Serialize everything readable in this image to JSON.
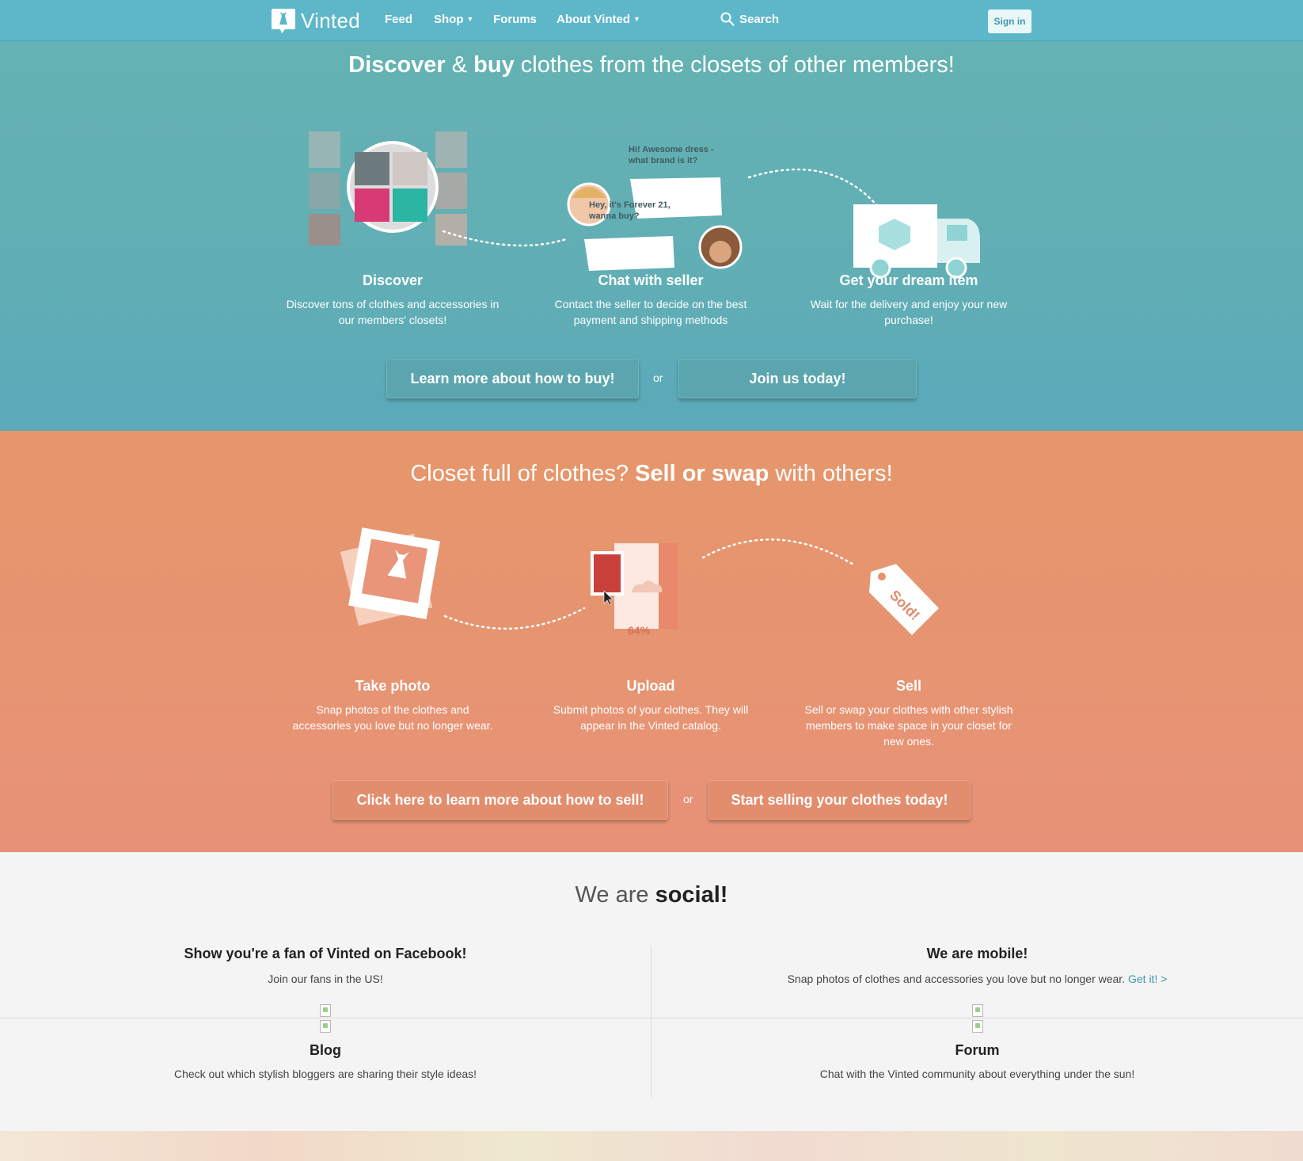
{
  "nav": {
    "brand": "Vinted",
    "links": [
      {
        "label": "Feed",
        "dropdown": false
      },
      {
        "label": "Shop",
        "dropdown": true
      },
      {
        "label": "Forums",
        "dropdown": false
      },
      {
        "label": "About Vinted",
        "dropdown": true
      }
    ],
    "search_label": "Search",
    "signin_label": "Sign in"
  },
  "buy": {
    "title_strong_1": "Discover",
    "title_mid": " & ",
    "title_strong_2": "buy",
    "title_rest": " clothes from the closets of other members!",
    "chat_bubble_1": "Hi! Awesome dress - what brand is it?",
    "chat_bubble_2": "Hey, it's Forever 21, wanna buy?",
    "steps": [
      {
        "title": "Discover",
        "text": "Discover tons of clothes and accessories in our members' closets!"
      },
      {
        "title": "Chat with seller",
        "text": "Contact the seller to decide on the best payment and shipping methods"
      },
      {
        "title": "Get your dream item",
        "text": "Wait for the delivery and enjoy your new purchase!"
      }
    ],
    "btn_learn": "Learn more about how to buy!",
    "or": "or",
    "btn_join": "Join us today!",
    "bg_color": "#62aeb5"
  },
  "sell": {
    "title_pre": "Closet full of clothes? ",
    "title_strong": "Sell or swap",
    "title_rest": " with others!",
    "upload_percent": "64%",
    "tag_text": "Sold!",
    "steps": [
      {
        "title": "Take photo",
        "text": "Snap photos of the clothes and accessories you love but no longer wear."
      },
      {
        "title": "Upload",
        "text": "Submit photos of your clothes. They will appear in the Vinted catalog."
      },
      {
        "title": "Sell",
        "text": "Sell or swap your clothes with other stylish members to make space in your closet for new ones."
      }
    ],
    "btn_learn": "Click here to learn more about how to sell!",
    "or": "or",
    "btn_start": "Start selling your clothes today!",
    "bg_color": "#e6946f"
  },
  "social": {
    "title_pre": "We are ",
    "title_strong": "social!",
    "facebook": {
      "title": "Show you're a fan of Vinted on Facebook!",
      "text": "Join our fans in the US!"
    },
    "mobile": {
      "title": "We are mobile!",
      "text": "Snap photos of clothes and accessories you love but no longer wear.",
      "link": "Get it! >"
    },
    "blog": {
      "title": "Blog",
      "text": "Check out which stylish bloggers are sharing their style ideas!"
    },
    "forum": {
      "title": "Forum",
      "text": "Chat with the Vinted community about everything under the sun!"
    }
  }
}
